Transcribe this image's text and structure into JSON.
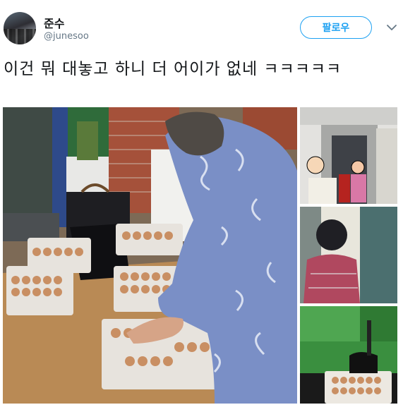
{
  "user": {
    "name": "준수",
    "handle": "@junesoo"
  },
  "follow_label": "팔로우",
  "tweet_text": "이건 뭐 대놓고 하니 더 어이가 없네 ㅋㅋㅋㅋㅋ",
  "icons": {
    "more": "chevron-down-icon"
  },
  "colors": {
    "accent": "#1da1f2",
    "text": "#14171a",
    "muted": "#657786"
  }
}
